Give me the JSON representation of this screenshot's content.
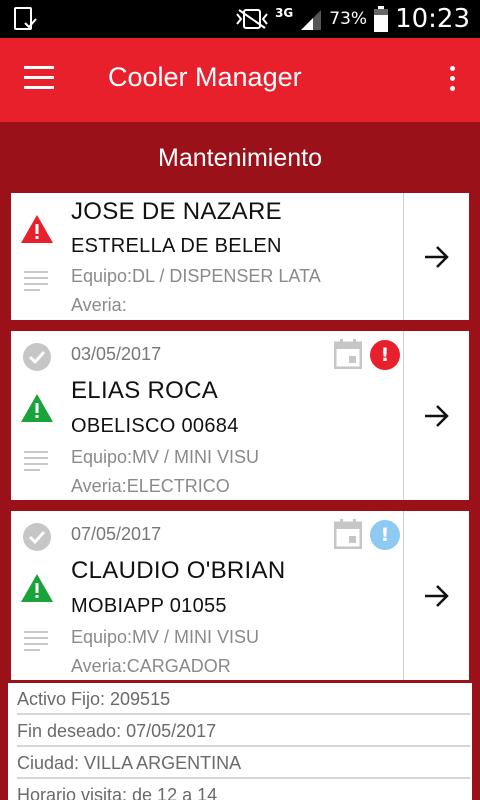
{
  "status_bar": {
    "battery_percent": "73%",
    "network": "3G",
    "time": "10:23",
    "icons": [
      "download-icon",
      "vibrate-mute-icon",
      "signal-icon",
      "battery-icon"
    ]
  },
  "app_bar": {
    "title": "Cooler Manager",
    "accent_color": "#e8202c",
    "background_color": "#9b1119"
  },
  "section_title": "Mantenimiento",
  "cards": [
    {
      "name": "JOSE DE NAZARE",
      "store": "ESTRELLA DE BELEN",
      "equipo": "Equipo:DL / DISPENSER LATA",
      "averia": "Averia:",
      "warning_color": "#e8202c",
      "status_icon": "warning-triangle-icon"
    },
    {
      "date": "03/05/2017",
      "name": "ELIAS ROCA",
      "store": "OBELISCO 00684",
      "equipo": "Equipo:MV / MINI VISU",
      "averia": "Averia:ELECTRICO",
      "warning_color": "#1aa33a",
      "badge_color": "#e8202c",
      "badge_text": "!"
    },
    {
      "date": "07/05/2017",
      "name": "CLAUDIO O'BRIAN",
      "store": "MOBIAPP 01055",
      "equipo": "Equipo:MV / MINI VISU",
      "averia": "Averia:CARGADOR",
      "warning_color": "#1aa33a",
      "badge_color": "#8ec9f2",
      "badge_text": "!"
    }
  ],
  "details": {
    "activo_fijo": "Activo Fijo: 209515",
    "fin_deseado": "Fin deseado: 07/05/2017",
    "ciudad": "Ciudad: VILLA ARGENTINA",
    "horario": "Horario visita: de 12 a 14"
  }
}
